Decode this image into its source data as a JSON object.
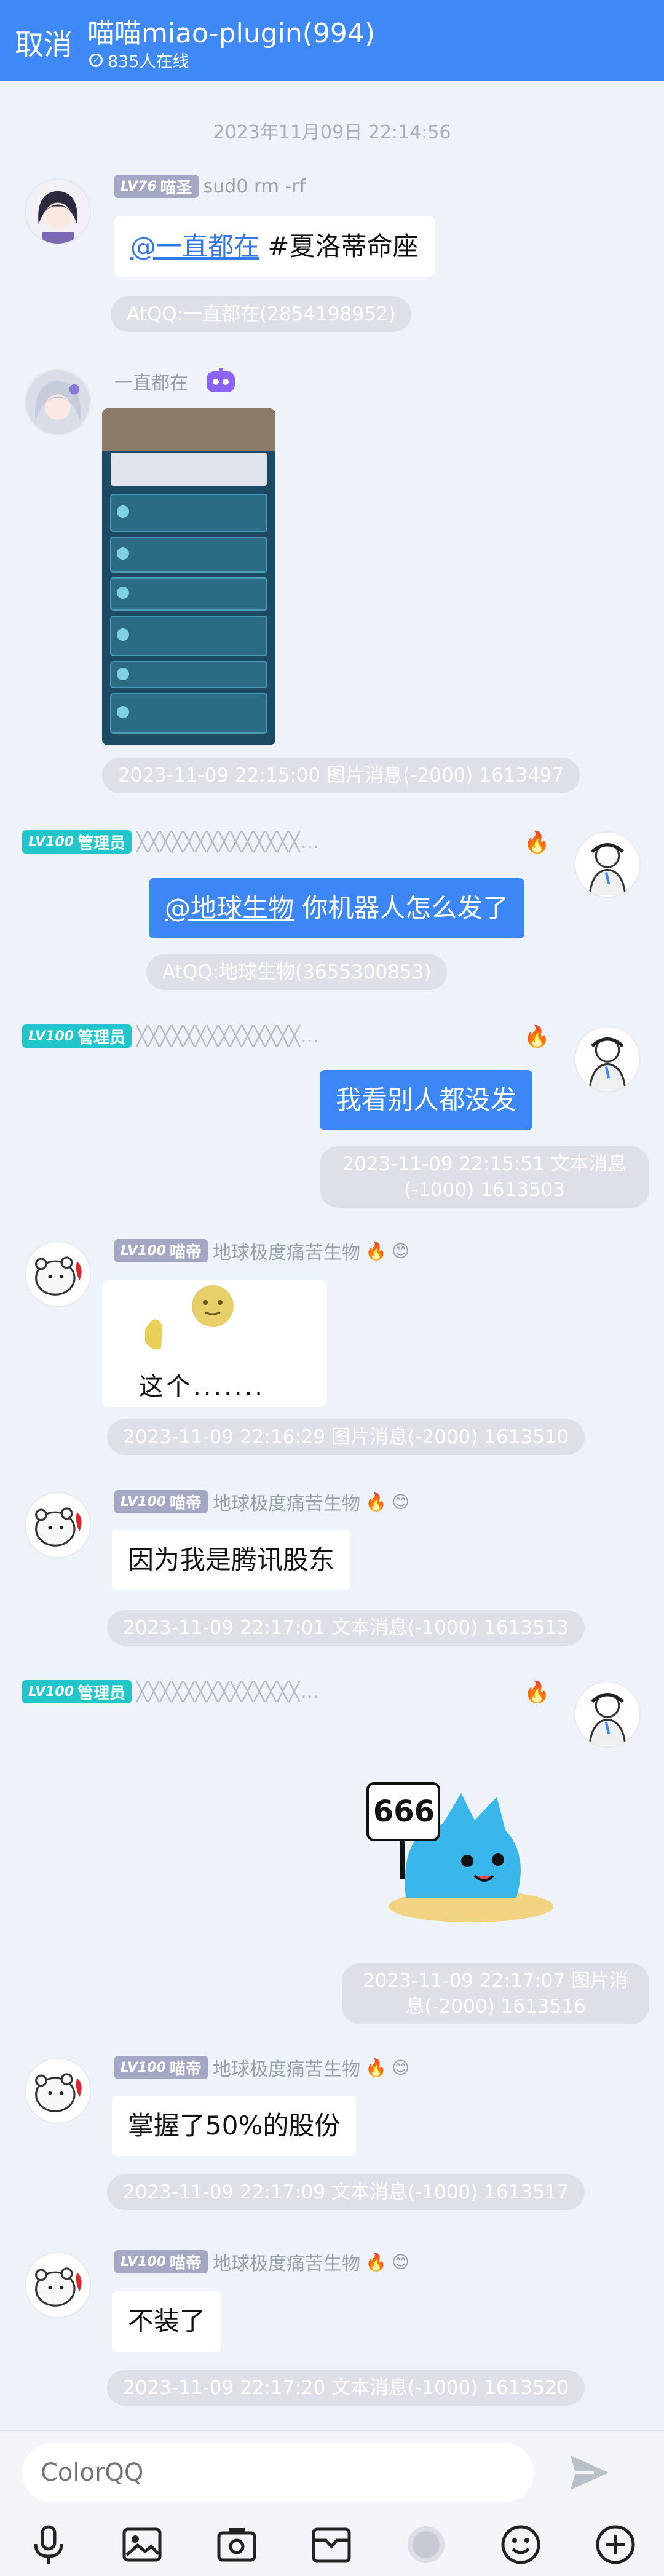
{
  "header": {
    "cancel_label": "取消",
    "group_title": "喵喵miao-plugin(994)",
    "online_count": "835人在线"
  },
  "messages": {
    "ts1": "2023年11月09日 22:14:56",
    "m1": {
      "level": "LV76",
      "title": "喵圣",
      "name": "sud0 rm -rf",
      "mention": "@一直都在",
      "text": " #夏洛蒂命座",
      "info": "AtQQ:一直都在(2854198952)"
    },
    "m2": {
      "name": "一直都在",
      "info": "2023-11-09 22:15:00 图片消息(-2000) 1613497"
    },
    "m3": {
      "level": "LV100",
      "title": "管理员",
      "mention": "@地球生物",
      "text": " 你机器人怎么发了",
      "info": "AtQQ:地球生物(3655300853)"
    },
    "m4": {
      "level": "LV100",
      "title": "管理员",
      "text": "我看别人都没发",
      "info": "2023-11-09 22:15:51 文本消息(-1000) 1613503"
    },
    "m5": {
      "level": "LV100",
      "title": "喵帝",
      "name": "地球极度痛苦生物",
      "caption": "这个.......",
      "info": "2023-11-09 22:16:29 图片消息(-2000) 1613510"
    },
    "m6": {
      "level": "LV100",
      "title": "喵帝",
      "name": "地球极度痛苦生物",
      "text": "因为我是腾讯股东",
      "info": "2023-11-09 22:17:01 文本消息(-1000) 1613513"
    },
    "m7": {
      "level": "LV100",
      "title": "管理员",
      "sticker_text": "666",
      "info": "2023-11-09 22:17:07 图片消息(-2000) 1613516"
    },
    "m8": {
      "level": "LV100",
      "title": "喵帝",
      "name": "地球极度痛苦生物",
      "text": "掌握了50%的股份",
      "info": "2023-11-09 22:17:09 文本消息(-1000) 1613517"
    },
    "m9": {
      "level": "LV100",
      "title": "喵帝",
      "name": "地球极度痛苦生物",
      "text": "不装了",
      "info": "2023-11-09 22:17:20 文本消息(-1000) 1613520"
    }
  },
  "input": {
    "placeholder": "ColorQQ"
  },
  "toolbar": [
    "microphone-icon",
    "image-icon",
    "camera-icon",
    "folder-icon",
    "sticker-icon",
    "emoji-icon",
    "plus-icon"
  ],
  "colors": {
    "accent": "#3f89f6",
    "bubble_blue": "#3d86f5",
    "admin_badge": "#20c6c9",
    "level_badge": "#a4a8c4"
  }
}
